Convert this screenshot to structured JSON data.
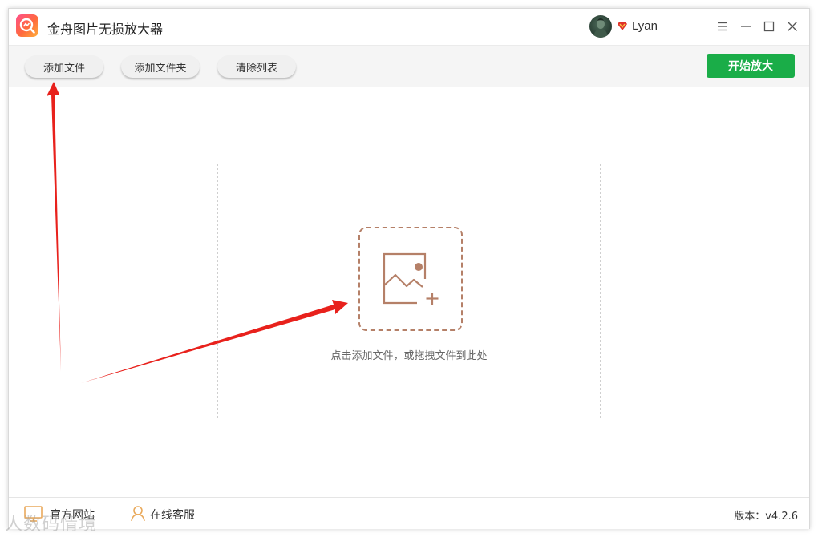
{
  "app": {
    "title": "金舟图片无损放大器",
    "user": "Lyan",
    "accent_color": "#1aad48",
    "upload_color": "#b58068"
  },
  "window_controls": {
    "menu_icon": "hamburger-menu-icon",
    "minimize_icon": "minimize-icon",
    "maximize_icon": "maximize-icon",
    "close_icon": "close-icon"
  },
  "toolbar": {
    "add_file": "添加文件",
    "add_folder": "添加文件夹",
    "clear_list": "清除列表",
    "start": "开始放大"
  },
  "dropzone": {
    "hint": "点击添加文件，或拖拽文件到此处",
    "icon": "image-add-icon"
  },
  "statusbar": {
    "website": "官方网站",
    "support": "在线客服",
    "version": "版本：v4.2.6"
  },
  "watermark": {
    "text": "人数码情境"
  }
}
